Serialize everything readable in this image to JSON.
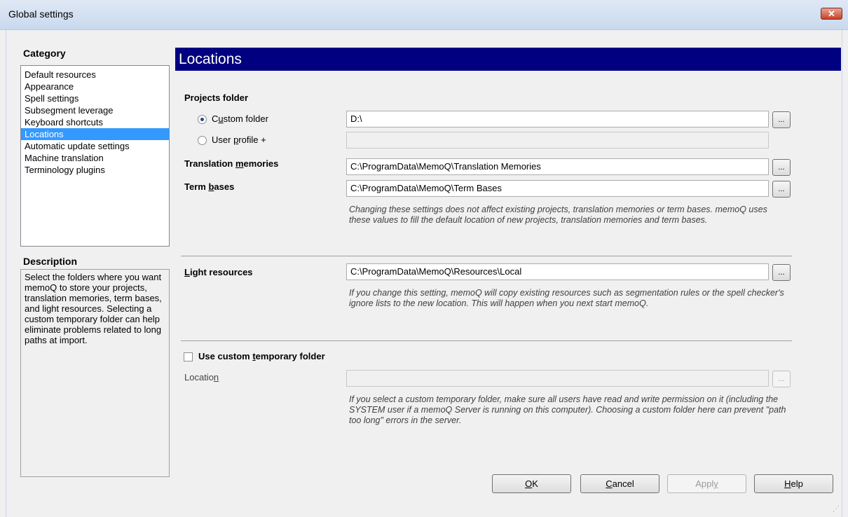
{
  "window": {
    "title": "Global settings",
    "close_label": "✕"
  },
  "category": {
    "heading": "Category",
    "items": [
      {
        "label": "Default resources",
        "selected": false
      },
      {
        "label": "Appearance",
        "selected": false
      },
      {
        "label": "Spell settings",
        "selected": false
      },
      {
        "label": "Subsegment leverage",
        "selected": false
      },
      {
        "label": "Keyboard shortcuts",
        "selected": false
      },
      {
        "label": "Locations",
        "selected": true
      },
      {
        "label": "Automatic update settings",
        "selected": false
      },
      {
        "label": "Machine translation",
        "selected": false
      },
      {
        "label": "Terminology plugins",
        "selected": false
      }
    ]
  },
  "description": {
    "heading": "Description",
    "text": "Select the folders where you want memoQ to store your projects, translation memories, term bases, and light resources. Selecting a custom temporary folder can help eliminate problems related to long paths at import."
  },
  "page": {
    "title": "Locations"
  },
  "projects": {
    "heading": "Projects folder",
    "custom_label_pre": "C",
    "custom_label_u": "u",
    "custom_label_post": "stom folder",
    "custom_value": "D:\\",
    "profile_label_pre": "User ",
    "profile_label_u": "p",
    "profile_label_post": "rofile +",
    "profile_value": ""
  },
  "tm": {
    "label_pre": "Translation ",
    "label_u": "m",
    "label_post": "emories",
    "value": "C:\\ProgramData\\MemoQ\\Translation Memories"
  },
  "tb": {
    "label_pre": "Term ",
    "label_u": "b",
    "label_post": "ases",
    "value": "C:\\ProgramData\\MemoQ\\Term Bases"
  },
  "note1": "Changing these settings does not affect existing projects, translation memories or term bases. memoQ uses these values to fill the default location of new projects, translation memories and term bases.",
  "light": {
    "label_u": "L",
    "label_post": "ight resources",
    "value": "C:\\ProgramData\\MemoQ\\Resources\\Local",
    "note": "If you change this setting, memoQ will copy existing resources such as segmentation rules or the spell checker's ignore lists to the new location. This will happen when you next start memoQ."
  },
  "temp": {
    "checkbox_pre": "Use custom ",
    "checkbox_u": "t",
    "checkbox_post": "emporary folder",
    "location_pre": "Locatio",
    "location_u": "n",
    "value": "",
    "note": "If you select a custom temporary folder, make sure all users have read and write permission on it (including the SYSTEM user if a memoQ Server is running on this computer). Choosing a custom folder here can prevent \"path too long\" errors in the server."
  },
  "browse_label": "...",
  "buttons": {
    "ok_u": "O",
    "ok_post": "K",
    "cancel_u": "C",
    "cancel_post": "ancel",
    "apply_pre": "Appl",
    "apply_u": "y",
    "help_u": "H",
    "help_post": "elp"
  }
}
